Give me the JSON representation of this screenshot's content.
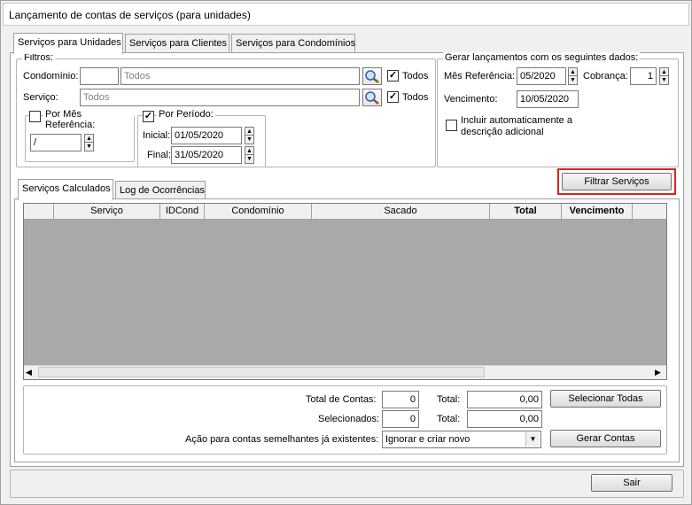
{
  "window": {
    "title": "Lançamento de contas de serviços (para unidades)"
  },
  "tabs": [
    {
      "label": "Serviços para Unidades"
    },
    {
      "label": "Serviços para Clientes"
    },
    {
      "label": "Serviços para Condomínios"
    }
  ],
  "filters": {
    "legend": "Filtros:",
    "condominio_label": "Condomínio:",
    "condominio_code": "",
    "condominio_value": "Todos",
    "condominio_todos": "Todos",
    "servico_label": "Serviço:",
    "servico_value": "Todos",
    "servico_todos": "Todos",
    "por_mes_label": "Por Mês Referência:",
    "mes_value": "/",
    "por_periodo_label": "Por Período:",
    "inicial_label": "Inicial:",
    "inicial_value": "01/05/2020",
    "final_label": "Final:",
    "final_value": "31/05/2020"
  },
  "gerar": {
    "legend": "Gerar lançamentos com os seguintes dados:",
    "mes_ref_label": "Mês Referência:",
    "mes_ref_value": "05/2020",
    "cobranca_label": "Cobrança:",
    "cobranca_value": "1",
    "vencimento_label": "Vencimento:",
    "vencimento_value": "10/05/2020",
    "incluir_line1": "Incluir automaticamente a",
    "incluir_line2": "descrição adicional"
  },
  "filtrar_button": "Filtrar Serviços",
  "result_tabs": [
    {
      "label": "Serviços Calculados"
    },
    {
      "label": "Log de Ocorrências"
    }
  ],
  "grid": {
    "columns": [
      "",
      "Serviço",
      "IDCond",
      "Condomínio",
      "Sacado",
      "Total",
      "Vencimento",
      ""
    ]
  },
  "totals": {
    "total_contas_label": "Total de Contas:",
    "total_contas_value": "0",
    "total_label": "Total:",
    "total_value": "0,00",
    "selecionados_label": "Selecionados:",
    "selecionados_value": "0",
    "total2_label": "Total:",
    "total2_value": "0,00",
    "acao_label": "Ação para contas semelhantes já existentes:",
    "acao_value": "Ignorar e criar novo",
    "selecionar_todas_button": "Selecionar Todas",
    "gerar_contas_button": "Gerar Contas"
  },
  "footer": {
    "sair_button": "Sair"
  },
  "colors": {
    "grid_bg": "#a9a9a9",
    "highlight": "#d9231f"
  }
}
